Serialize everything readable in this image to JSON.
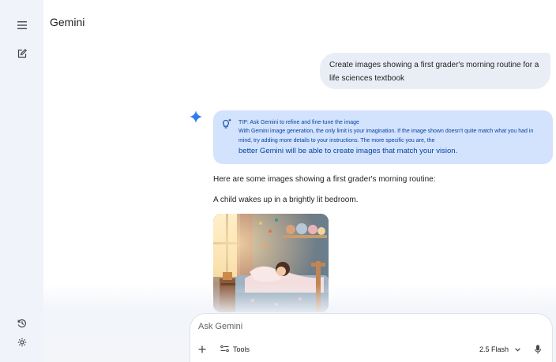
{
  "app": {
    "title": "Gemini"
  },
  "sidebar": {
    "icons": [
      "menu-icon",
      "new-chat-icon",
      "activity-icon",
      "settings-icon"
    ]
  },
  "conversation": {
    "user_prompt": "Create images showing a first grader's morning routine for a life sciences textbook",
    "tip": {
      "heading": "TIP: Ask Gemini to refine and fine-tune the image",
      "body_small": "With Gemini image generation, the only limit is your imagination. If the image shown doesn't quite match what you had in mind, try adding more details to your instructions. The more specific you are, the",
      "body_large": "better Gemini will be able to create images that match your vision."
    },
    "response_intro": "Here are some images showing a first grader's morning routine:",
    "caption_1": "A child wakes up in a brightly lit bedroom."
  },
  "composer": {
    "placeholder": "Ask Gemini",
    "tools_label": "Tools",
    "model_label": "2.5 Flash"
  },
  "colors": {
    "accent": "#4285f4",
    "tip_bg": "#d3e3fd",
    "tip_text": "#0842a0",
    "user_bubble": "#e9eef6",
    "rail_bg": "#f0f3f9"
  }
}
